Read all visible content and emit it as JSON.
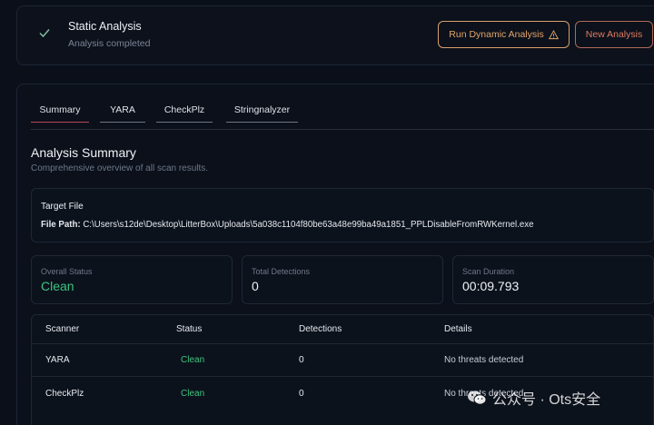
{
  "status": {
    "title": "Static Analysis",
    "subtitle": "Analysis completed",
    "icon": "check-icon"
  },
  "actions": {
    "dynamic_label": "Run Dynamic Analysis",
    "dynamic_icon": "warning-icon",
    "new_label": "New Analysis"
  },
  "tabs": [
    {
      "label": "Summary",
      "active": true
    },
    {
      "label": "YARA",
      "active": false
    },
    {
      "label": "CheckPlz",
      "active": false
    },
    {
      "label": "Stringnalyzer",
      "active": false
    }
  ],
  "summary": {
    "title": "Analysis Summary",
    "subtitle": "Comprehensive overview of all scan results."
  },
  "target": {
    "heading": "Target File",
    "path_label": "File Path:",
    "path_value": "C:\\Users\\s12de\\Desktop\\LitterBox\\Uploads\\5a038c1104f80be63a48e99ba49a1851_PPLDisableFromRWKernel.exe"
  },
  "stats": [
    {
      "label": "Overall Status",
      "value": "Clean"
    },
    {
      "label": "Total Detections",
      "value": "0"
    },
    {
      "label": "Scan Duration",
      "value": "00:09.793"
    }
  ],
  "table": {
    "headers": [
      "Scanner",
      "Status",
      "Detections",
      "Details"
    ],
    "rows": [
      {
        "scanner": "YARA",
        "status": "Clean",
        "detections": "0",
        "details": "No threats detected"
      },
      {
        "scanner": "CheckPlz",
        "status": "Clean",
        "detections": "0",
        "details": "No threats detected"
      }
    ]
  },
  "watermark": {
    "text": "公众号 · Ots安全",
    "icon": "wechat-icon"
  },
  "colors": {
    "accent_orange": "#e3a56b",
    "accent_red": "#e07a62",
    "clean_green": "#3cc47f",
    "active_tab": "#b6485a",
    "background": "#0a0f19"
  }
}
